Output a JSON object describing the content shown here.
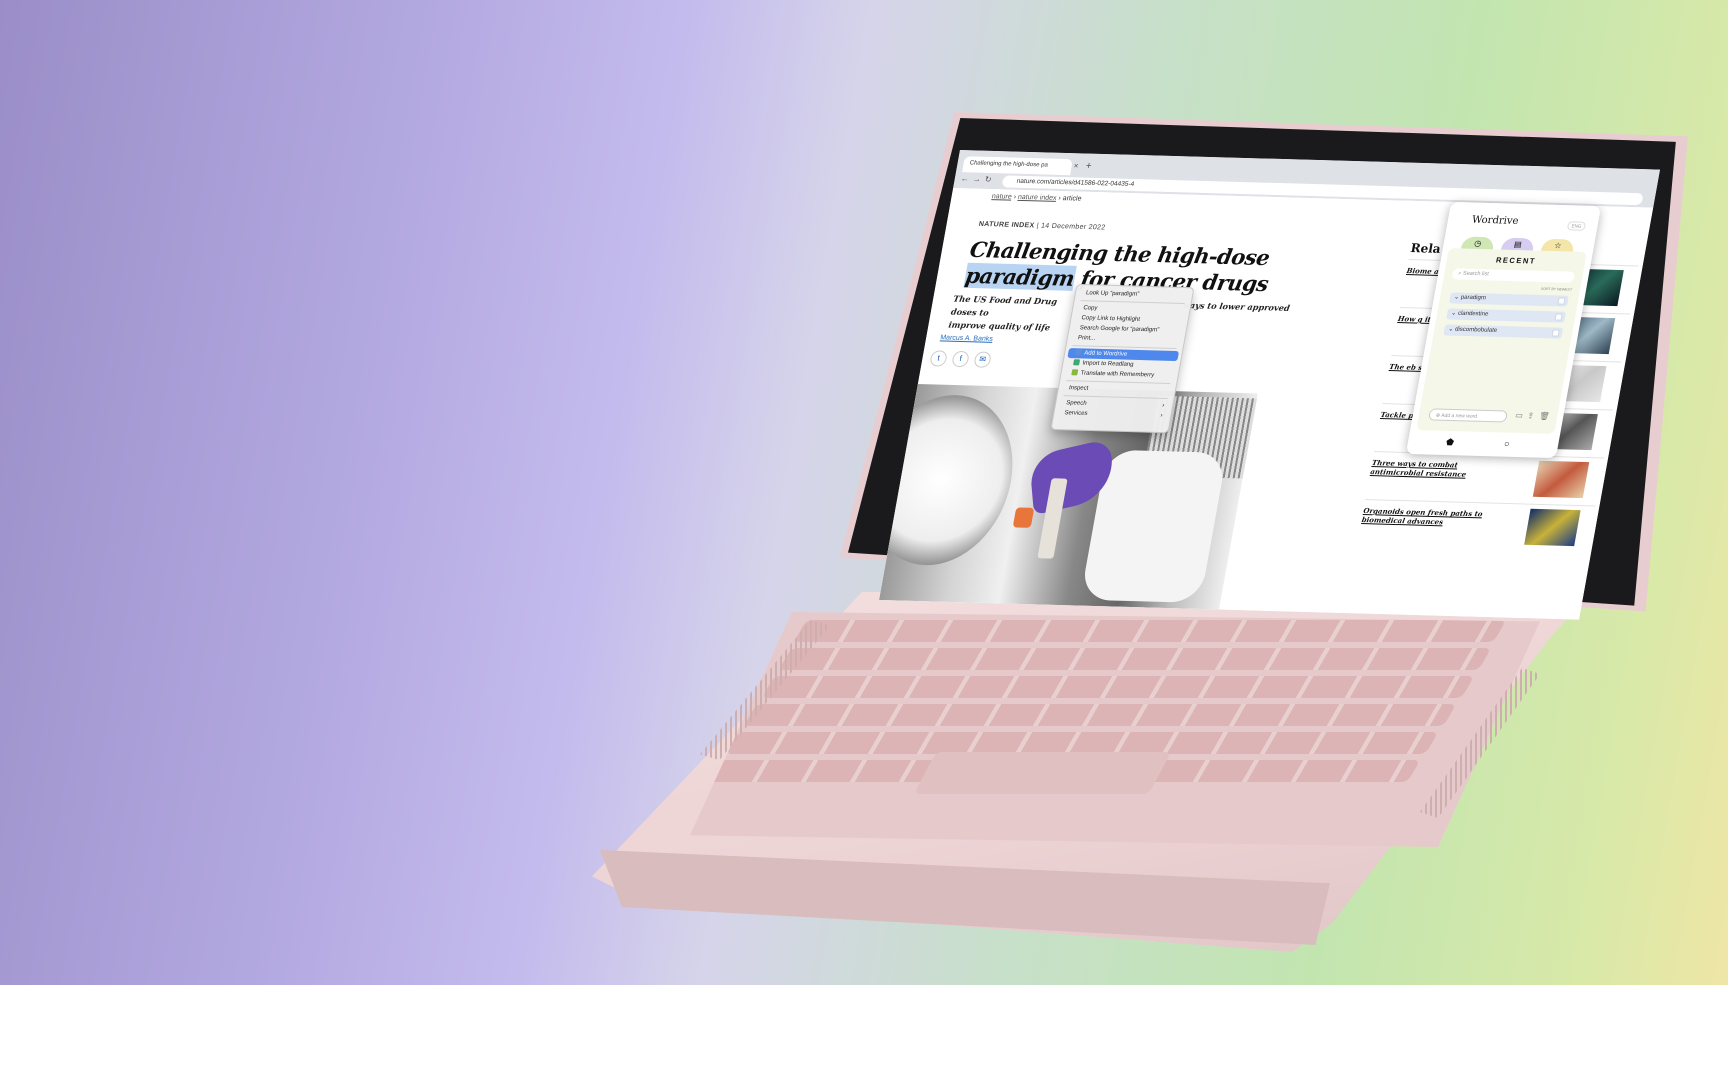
{
  "browser": {
    "tab_title": "Challenging the high-dose pa",
    "tab_close": "×",
    "new_tab": "+",
    "url": "nature.com/articles/d41586-022-04435-4",
    "back_icon": "←",
    "forward_icon": "→",
    "reload_icon": "↻"
  },
  "breadcrumb": {
    "items": [
      "nature",
      "nature index",
      "article"
    ],
    "separator": "›"
  },
  "article": {
    "kicker": "NATURE INDEX",
    "date": "14 December 2022",
    "headline_part1": "Challenging the high-dose",
    "headline_highlight": "paradigm",
    "headline_part2": " for cancer drugs",
    "standfirst_start": "The US Food and Drug",
    "standfirst_end": "ways to lower approved doses to",
    "standfirst_line2": "improve quality of life",
    "author": "Marcus A. Banks",
    "share": [
      "twitter-icon",
      "facebook-icon",
      "email-icon"
    ]
  },
  "context_menu": {
    "items": [
      {
        "label": "Look Up “paradigm”"
      },
      {
        "sep": true
      },
      {
        "label": "Copy"
      },
      {
        "label": "Copy Link to Highlight"
      },
      {
        "label": "Search Google for “paradigm”"
      },
      {
        "label": "Print..."
      },
      {
        "sep": true
      },
      {
        "label": "Add to Wordrive",
        "highlighted": true,
        "icon_color": "#5b8fd9"
      },
      {
        "label": "Import to Readlang",
        "icon_color": "#3fa86e"
      },
      {
        "label": "Translate with Rememberry",
        "icon_color": "#8ab83f"
      },
      {
        "sep": true
      },
      {
        "label": "Inspect"
      },
      {
        "sep": true
      },
      {
        "label": "Speech",
        "submenu": true
      },
      {
        "label": "Services",
        "submenu": true
      }
    ],
    "submenu_glyph": "›"
  },
  "related": {
    "title": "Rela",
    "items": [
      {
        "title": "Biome age"
      },
      {
        "title": "How g its 'dar"
      },
      {
        "title": "The eb scienc"
      },
      {
        "title": "Tackle pande"
      },
      {
        "title": "Three ways to combat antimicrobial resistance"
      },
      {
        "title": "Organoids open fresh paths to biomedical advances"
      }
    ]
  },
  "wordrive": {
    "logo": "Wordrive",
    "lang_badge": "ENG",
    "tabs": [
      {
        "icon": "clock-icon",
        "glyph": "◷",
        "color": "#cfe6b5"
      },
      {
        "icon": "book-icon",
        "glyph": "▤",
        "color": "#d6cdf0"
      },
      {
        "icon": "star-icon",
        "glyph": "☆",
        "color": "#f3e6a8"
      }
    ],
    "section_title": "RECENT",
    "search_placeholder": "Search list",
    "sort_label": "SORT BY  NEWEST",
    "words": [
      "paradigm",
      "clandestine",
      "discombobulate"
    ],
    "add_placeholder": "Add a new word",
    "actions": [
      "▭",
      "⇪",
      "🗑"
    ],
    "footer": [
      "⬟",
      "○"
    ]
  }
}
